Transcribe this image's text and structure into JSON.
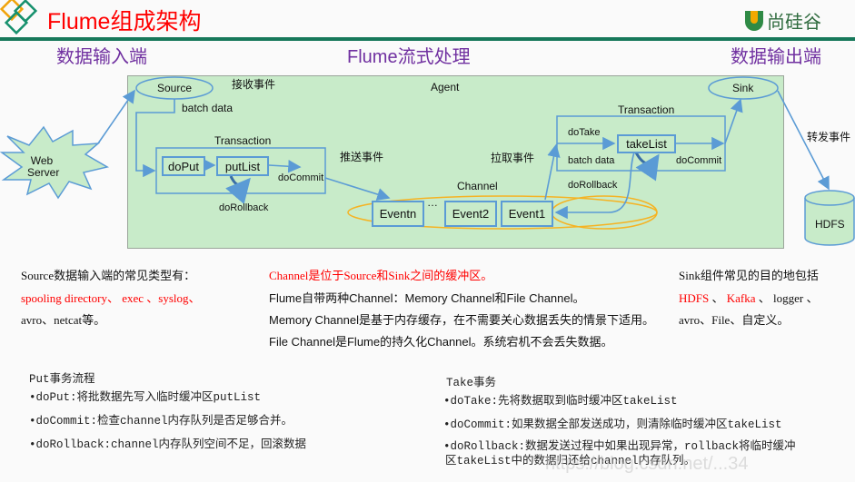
{
  "header": {
    "title": "Flume组成架构",
    "logo_text": "尚硅谷",
    "section_input": "数据输入端",
    "section_process": "Flume流式处理",
    "section_output": "数据输出端"
  },
  "diagram": {
    "web_server": "Web\nServer",
    "web_server_line1": "Web",
    "web_server_line2": "Server",
    "agent_label": "Agent",
    "source": "Source",
    "receive_event": "接收事件",
    "batch_data_in": "batch data",
    "put_transaction": {
      "label": "Transaction",
      "do_put": "doPut",
      "put_list": "putList",
      "do_commit": "doCommit",
      "do_rollback": "doRollback"
    },
    "push_event": "推送事件",
    "pull_event": "拉取事件",
    "channel": {
      "label": "Channel",
      "events": [
        "Eventn",
        "…",
        "Event2",
        "Event1"
      ]
    },
    "take_transaction": {
      "label": "Transaction",
      "do_take": "doTake",
      "take_list": "takeList",
      "batch_data": "batch data",
      "do_commit": "doCommit",
      "do_rollback": "doRollback"
    },
    "sink": "Sink",
    "forward_event": "转发事件",
    "hdfs": "HDFS"
  },
  "notes": {
    "source": {
      "heading": "Source数据输入端的常见类型有：",
      "highlight": "spooling directory、 exec 、syslog、",
      "rest": "avro、netcat等。"
    },
    "channel": {
      "heading": "Channel是位于Source和Sink之间的缓冲区。",
      "lines": [
        "Flume自带两种Channel：Memory Channel和File Channel。",
        "Memory Channel是基于内存缓存，在不需要关心数据丢失的情景下适用。",
        "File Channel是Flume的持久化Channel。系统宕机不会丢失数据。"
      ]
    },
    "sink": {
      "heading": "Sink组件常见的目的地包括",
      "highlight_1": "HDFS",
      "sep_1": " 、 ",
      "highlight_2": "Kafka",
      "rest_1": " 、 logger 、",
      "rest_2": "avro、File、自定义。"
    },
    "put": {
      "heading": "Put事务流程",
      "items": [
        "•doPut:将批数据先写入临时缓冲区putList",
        "•doCommit:检查channel内存队列是否足够合并。",
        "•doRollback:channel内存队列空间不足，回滚数据"
      ]
    },
    "take": {
      "heading": "Take事务",
      "items": [
        "•doTake:先将数据取到临时缓冲区takeList",
        "•doCommit:如果数据全部发送成功，则清除临时缓冲区takeList",
        "•doRollback:数据发送过程中如果出现异常，rollback将临时缓冲",
        "区takeList中的数据归还给channel内存队列。"
      ]
    }
  },
  "watermark": "https://blog.csdn.net/...34",
  "colors": {
    "title": "#ff0000",
    "section": "#7030a0",
    "rule": "#16785a",
    "agent_bg": "#c8ebc9",
    "line": "#5b9bd5",
    "channel": "#f5b323"
  }
}
